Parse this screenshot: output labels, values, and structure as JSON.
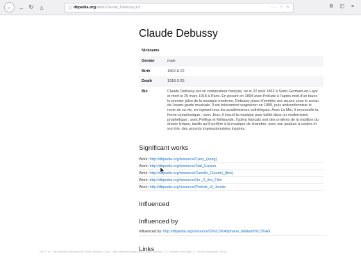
{
  "browser": {
    "nav": {
      "back": "←",
      "forward": "→",
      "reload": "↻",
      "home": "⌂"
    },
    "url": {
      "domain": "dbpedia.org",
      "path": "/data/Claude_Debussy.n3"
    },
    "url_actions": "··· ♡ ☆",
    "right_icons": "Ⅲ ◫ ≡"
  },
  "page": {
    "title": "Claude Debussy",
    "properties": [
      {
        "key": "Nickname",
        "value": ""
      },
      {
        "key": "Gender",
        "value": "male"
      },
      {
        "key": "Birth",
        "value": "1862-8-22"
      },
      {
        "key": "Death",
        "value": "1918-3-25"
      },
      {
        "key": "Bio",
        "value": "Claude Debussy est un compositeur français, né le 22 août 1862 à Saint-Germain-en-Laye et mort le 25 mars 1918 à Paris. En posant en 1894 avec Prélude à l'après-midi d'un faune le premier jalon de la musique moderne, Debussy place d'emblée son œuvre sous le sceau de l'avant-garde musicale. Il est brièvement wagnérien en 1889, puis anticonformiste le reste de sa vie, en rejetant tous les académismes esthétiques. Avec La Mer, il renouvelle la forme symphonique ; avec Jeux, il inscrit la musique pour ballet dans un modernisme prophétique ; avec Pelléas et Mélisande, l'opéra français sort des ornières de la tradition du drame lyrique, tandis qu'il confère à la musique de chambre, avec son quatuor à cordes et son trio, des accents impressionnistes inspirés."
      }
    ],
    "significant_works": {
      "heading": "Significant works",
      "label": "Work:",
      "items": [
        "http://dbpedia.org/resource/Cany_(song)",
        "http://dbpedia.org/resource/Stat_Gazers",
        "http://dbpedia.org/resource/Camille_Claudel_(film)",
        "http://dbpedia.org/resource/Ho._5_the_Film",
        "http://dbpedia.org/resource/Portrait_of_Jennie"
      ]
    },
    "influenced": {
      "heading": "Influenced"
    },
    "influenced_by": {
      "heading": "Influenced by",
      "label": "Influenced by:",
      "link": "http://dbpedia.org/resource/St%C3%A9phane_Mallarm%C3%A9"
    },
    "links": {
      "heading": "Links"
    },
    "footer": "Port 1 \"xr\" · http://dbpedia.org/resource/Claude_Debussy · Sub 1 \"http://dbpedia.org/resource/Claude_Debussy\" 13 · Semantic Web page · n · Stumpe Marguage, French"
  }
}
